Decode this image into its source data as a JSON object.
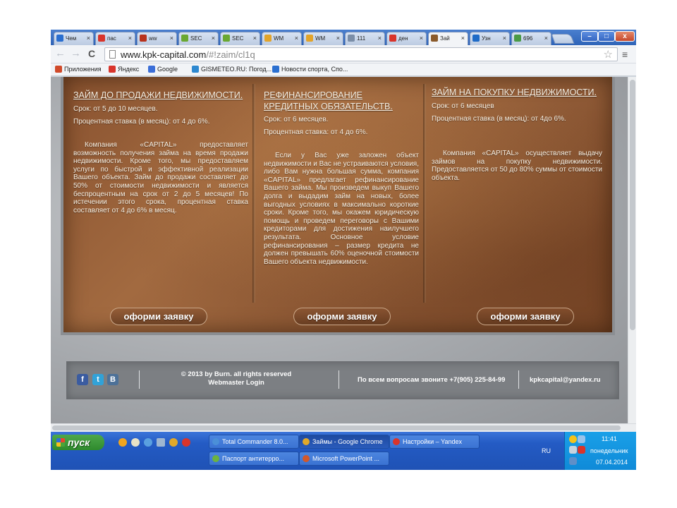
{
  "browser": {
    "tabs": [
      {
        "label": "Чем",
        "icon": "sports-news-icon",
        "color": "#2a6fd0"
      },
      {
        "label": "пас",
        "icon": "yandex-icon",
        "color": "#d9342b"
      },
      {
        "label": "ww",
        "icon": "chart-icon",
        "color": "#b8321d"
      },
      {
        "label": "SEC",
        "icon": "dollar-icon",
        "color": "#6aa832"
      },
      {
        "label": "SEC",
        "icon": "dollar-icon",
        "color": "#6aa832"
      },
      {
        "label": "WM",
        "icon": "webmoney-icon",
        "color": "#e3a42a"
      },
      {
        "label": "WM",
        "icon": "webmoney-icon",
        "color": "#e3a42a"
      },
      {
        "label": "111",
        "icon": "document-icon",
        "color": "#7b8ea8"
      },
      {
        "label": "ден",
        "icon": "yandex-icon",
        "color": "#d9342b"
      },
      {
        "label": "Зай",
        "icon": "kpk-capital-icon",
        "color": "#8a5a2b"
      },
      {
        "label": "Узн",
        "icon": "ip-icon",
        "color": "#1f6bc7"
      },
      {
        "label": "696",
        "icon": "sendspace-icon",
        "color": "#4a9a46"
      }
    ],
    "active_tab_index": 9,
    "url_domain": "www.kpk-capital.com",
    "url_rest": "/#!zaim/cl1q",
    "window_min": "–",
    "window_max": "□",
    "window_close": "x"
  },
  "bookmarks": [
    {
      "label": "Приложения",
      "icon": "apps-grid-icon",
      "color": "#d04a2a"
    },
    {
      "label": "Яндекс",
      "icon": "yandex-icon",
      "color": "#d9342b"
    },
    {
      "label": "Google",
      "icon": "google-icon",
      "color": "#3b6ed8"
    },
    {
      "label": "GISMETEO.RU: Погод...",
      "icon": "weather-drop-icon",
      "color": "#2d88d0"
    },
    {
      "label": "Новости спорта, Спо...",
      "icon": "sports-news-icon",
      "color": "#2a6fd0"
    }
  ],
  "offers": [
    {
      "title": "ЗАЙМ ДО ПРОДАЖИ НЕДВИЖИМОСТИ.",
      "term": "Срок: от 5 до 10 месяцев.",
      "rate": "Процентная ставка (в месяц): от 4 до 6%.",
      "body": "Компания «CAPITAL» предоставляет возможность получения займа на время продажи недвижимости. Кроме того, мы предоставляем услуги по быстрой и эффективной реализации Вашего объекта. Займ до продажи составляет до 50% от стоимости недвижимости и является беспроцентным на срок от 2 до 5 месяцев! По истечении этого срока, процентная ставка составляет от 4 до 6% в месяц.",
      "button": "оформи заявку"
    },
    {
      "title": "РЕФИНАНСИРОВАНИЕ КРЕДИТНЫХ ОБЯЗАТЕЛЬСТВ.",
      "term": "Срок: от 6 месяцев.",
      "rate": "Процентная ставка: от 4 до 6%.",
      "body": "Если у Вас уже заложен объект недвижимости и Вас не устраиваются условия, либо Вам нужна большая сумма, компания «CAPITAL» предлагает рефинансирование Вашего займа. Мы произведем выкуп Вашего долга и выдадим займ на новых, более выгодных условиях в максимально короткие сроки. Кроме того, мы окажем юридическую помощь и проведем переговоры с Вашими кредиторами для достижения наилучшего результата. Основное условие рефинансирования – размер кредита не должен превышать 60% оценочной стоимости Вашего объекта недвижимости.",
      "button": "оформи заявку"
    },
    {
      "title": "ЗАЙМ НА ПОКУПКУ НЕДВИЖИМОСТИ.",
      "term": "Срок: от 6 месяцев",
      "rate": "Процентная ставка (в месяц): от 4до 6%.",
      "body": "Компания «CAPITAL» осуществляет выдачу займов на покупку недвижимости. Предоставляется от 50 до 80% суммы от стоимости объекта.",
      "button": "оформи заявку"
    }
  ],
  "footer": {
    "social": {
      "facebook": "f",
      "twitter": "t",
      "vk": "B"
    },
    "copyright_line1": "© 2013 by Burn. all rights reserved",
    "copyright_line2": "Webmaster Login",
    "phone": "По всем вопросам звоните +7(905) 225-84-99",
    "email": "kpkcapital@yandex.ru"
  },
  "taskbar": {
    "start_label": "пуск",
    "tasks": [
      {
        "label": "Total Commander 8.0...",
        "icon": "total-commander-icon",
        "color": "#4b8fd8"
      },
      {
        "label": "Займы - Google Chrome",
        "icon": "chrome-icon",
        "color": "#e0a82a"
      },
      {
        "label": "Настройки – Yandex",
        "icon": "yandex-browser-icon",
        "color": "#d9342b"
      },
      {
        "label": "Паспорт антитерро...",
        "icon": "document-icon",
        "color": "#6cb33f"
      },
      {
        "label": "Microsoft PowerPoint ...",
        "icon": "powerpoint-icon",
        "color": "#d2582a"
      }
    ],
    "active_task_index": 1,
    "language": "RU",
    "time": "11:41",
    "weekday": "понедельник",
    "date": "07.04.2014"
  }
}
